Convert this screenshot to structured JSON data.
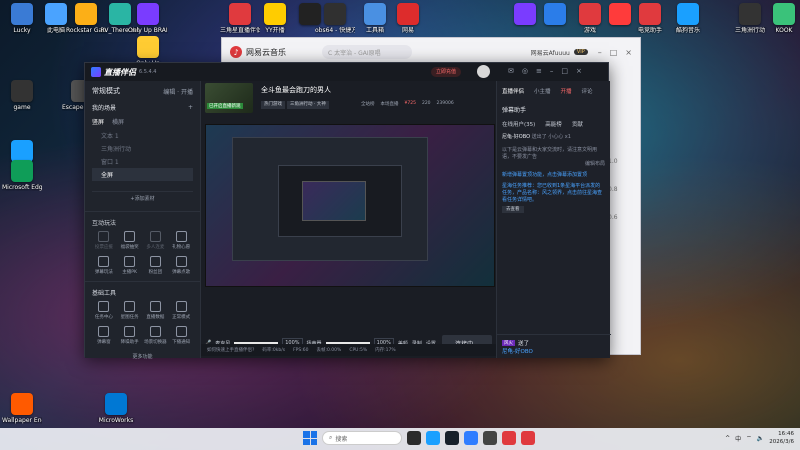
{
  "desktop": {
    "icons_left": [
      {
        "label": "Lucky",
        "color": "#3a7bd5"
      },
      {
        "label": "此电脑",
        "color": "#4aa3ff"
      },
      {
        "label": "Rockstar Games",
        "color": "#fcaf17"
      },
      {
        "label": "RV_There Yet",
        "color": "#2ab5a4"
      },
      {
        "label": "Only Up BRAINR...",
        "color": "#7a3cff"
      },
      {
        "label": "Only Up",
        "color": "#ffcc33"
      },
      {
        "label": "game",
        "color": "#333333"
      },
      {
        "label": "Escape From...",
        "color": "#555555"
      },
      {
        "label": "QQ",
        "color": "#1aa0ff"
      },
      {
        "label": "Microsoft Edge",
        "color": "#0f9d58"
      },
      {
        "label": "Wallpaper Engine",
        "color": "#ff5a00"
      },
      {
        "label": "MicroWorks",
        "color": "#0078d4"
      }
    ],
    "icons_top": [
      {
        "label": "三角星直播伴侣",
        "color": "#e03a3e"
      },
      {
        "label": "YY开播",
        "color": "#ffcc00"
      },
      {
        "label": "",
        "color": "#222222"
      },
      {
        "label": "obs64 - 快捷方式",
        "color": "#303030"
      },
      {
        "label": "工具箱",
        "color": "#4a90e2"
      },
      {
        "label": "网易",
        "color": "#dd2c2c"
      }
    ],
    "icons_right": [
      {
        "label": "",
        "color": "#7a3cff"
      },
      {
        "label": "",
        "color": "#2b7de9"
      },
      {
        "label": "游戏",
        "color": "#e03a3e"
      },
      {
        "label": "",
        "color": "#ff3b3b"
      },
      {
        "label": "电竞助手",
        "color": "#e03a3e"
      },
      {
        "label": "酷狗音乐",
        "color": "#1aa0ff"
      },
      {
        "label": "三角洲行动",
        "color": "#333333"
      },
      {
        "label": "KOOK",
        "color": "#3ac27a"
      }
    ]
  },
  "music_window": {
    "title": "网易云音乐",
    "search_placeholder": "C 太宰治 - GAI原唱",
    "user": "网易云Afuuuu",
    "vip": "VIP",
    "side_labels": [
      "1.0",
      "0.8",
      "0.6"
    ]
  },
  "app": {
    "name": "直播伴侣",
    "version": "6.5.4.4",
    "status_pill": "立即充值",
    "mode": "常规模式",
    "mode_actions": [
      "编辑",
      "开播"
    ],
    "my_scene": "我的场景",
    "scene_tabs": [
      "竖屏",
      "横屏"
    ],
    "sources": [
      "文本 1",
      "三角洲行动",
      "窗口 1",
      "全屏"
    ],
    "add_source": "添加素材",
    "interaction_title": "互动玩法",
    "interaction": [
      {
        "label": "投票应援",
        "dim": true
      },
      {
        "label": "福袋抽奖",
        "dim": false
      },
      {
        "label": "多人连麦",
        "dim": true
      },
      {
        "label": "礼物心愿",
        "dim": false
      },
      {
        "label": "弹幕玩法",
        "dim": false
      },
      {
        "label": "主播PK",
        "dim": false
      },
      {
        "label": "粉丝团",
        "dim": false
      },
      {
        "label": "弹幕点歌",
        "dim": false
      }
    ],
    "tools_title": "基础工具",
    "tools": [
      {
        "label": "任务中心",
        "dim": false
      },
      {
        "label": "星图任务",
        "dim": false
      },
      {
        "label": "直播数据",
        "dim": false
      },
      {
        "label": "正常模式",
        "dim": false
      },
      {
        "label": "弹幕窗",
        "dim": false
      },
      {
        "label": "降噪助手",
        "dim": false
      },
      {
        "label": "场景切换器",
        "dim": false
      },
      {
        "label": "下播通知",
        "dim": false
      }
    ],
    "more_tools": "更多功能",
    "room": {
      "thumb_label": "已开启直播新观",
      "title": "全斗鱼最会跑刀的男人",
      "tags": [
        "热门游戏",
        "三角洲行动 · 大神"
      ],
      "meta": [
        "全站榜",
        "本场直播",
        "¥725",
        "220",
        "239006"
      ]
    },
    "controls": {
      "mic_label": "麦克风",
      "mic_pct": "100%",
      "speaker_label": "扬声器",
      "speaker_pct": "100%",
      "buttons": [
        "美颜",
        "录制",
        "设置"
      ],
      "live_button": "连接中..."
    },
    "statusbar": [
      "如何快速上手直播伴侣?",
      "码率:0kb/s",
      "FPS:60",
      "丢帧:0.00%",
      "CPU:5%",
      "内存:17%"
    ],
    "right": {
      "tabs": [
        "直播伴侣",
        "小主播",
        "开播",
        "评论"
      ],
      "section": "弹幕助手",
      "subtabs": [
        "在线用户(35)",
        "高能榜",
        "贡献"
      ],
      "lines": [
        {
          "user": "尼龟-好OBO",
          "text": "送出了 小心心 x1"
        },
        {
          "user": "",
          "text": "以下是云弹幕和大家交流时，请注意文明用语，不要发广告"
        },
        {
          "user": "",
          "text": "编辑布局"
        }
      ],
      "notice": "新增弹幕置顶功能，点击弹幕添加置顶",
      "task": "星海任务推荐：您已收到1条星海平台派发的任务，产品名称：风之领界，点击前往星海查看任务详情吧。",
      "go_button": "去查看",
      "input_tag": "风火",
      "input_name": "尼龟-好OBO",
      "input_hint": "送了"
    }
  },
  "taskbar": {
    "search": "搜索",
    "time": "16:46",
    "date": "2026/3/6",
    "lang": "中"
  }
}
